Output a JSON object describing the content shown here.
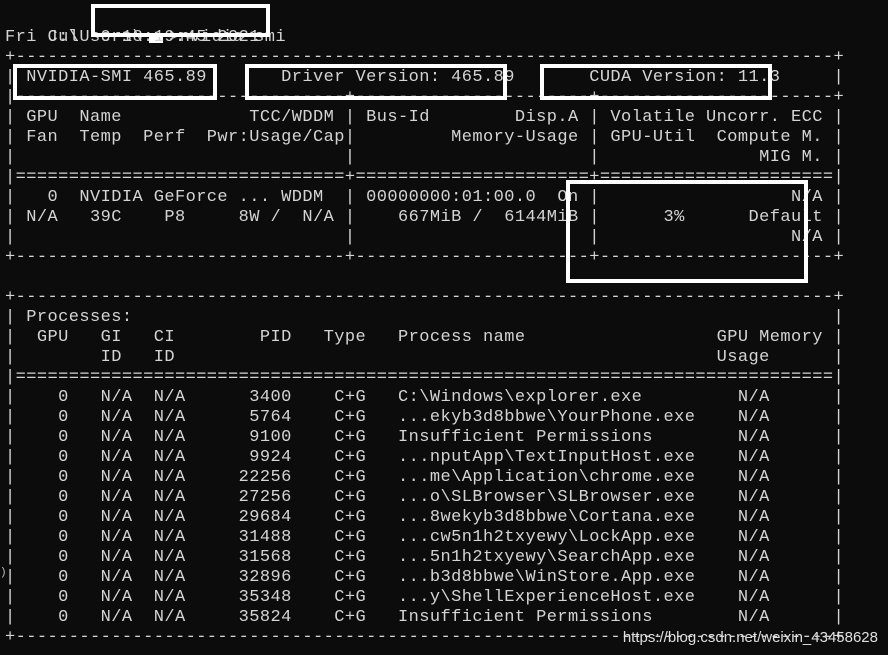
{
  "window": {
    "prompt_prefix": "C:\\Users\\",
    "username_icon": "redacted-username-icon",
    "command": ">nvidia-smi"
  },
  "terminal": {
    "lines": [
      "",
      "Fri Jul  9 18:19:45 2021",
      "+-----------------------------------------------------------------------------+",
      "| NVIDIA-SMI 465.89       Driver Version: 465.89       CUDA Version: 11.3     |",
      "|-------------------------------+----------------------+----------------------+",
      "| GPU  Name            TCC/WDDM | Bus-Id        Disp.A | Volatile Uncorr. ECC |",
      "| Fan  Temp  Perf  Pwr:Usage/Cap|         Memory-Usage | GPU-Util  Compute M. |",
      "|                               |                      |               MIG M. |",
      "|===============================+======================+======================|",
      "|   0  NVIDIA GeForce ... WDDM  | 00000000:01:00.0  On |                  N/A |",
      "| N/A   39C    P8     8W /  N/A |    667MiB /  6144MiB |      3%      Default |",
      "|                               |                      |                  N/A |",
      "+-------------------------------+----------------------+----------------------+",
      "",
      "+-----------------------------------------------------------------------------+",
      "| Processes:                                                                  |",
      "|  GPU   GI   CI        PID   Type   Process name                  GPU Memory |",
      "|        ID   ID                                                   Usage      |",
      "|=============================================================================|",
      "|    0   N/A  N/A      3400    C+G   C:\\Windows\\explorer.exe         N/A      |",
      "|    0   N/A  N/A      5764    C+G   ...ekyb3d8bbwe\\YourPhone.exe    N/A      |",
      "|    0   N/A  N/A      9100    C+G   Insufficient Permissions        N/A      |",
      "|    0   N/A  N/A      9924    C+G   ...nputApp\\TextInputHost.exe    N/A      |",
      "|    0   N/A  N/A     22256    C+G   ...me\\Application\\chrome.exe    N/A      |",
      "|    0   N/A  N/A     27256    C+G   ...o\\SLBrowser\\SLBrowser.exe    N/A      |",
      "|    0   N/A  N/A     29684    C+G   ...8wekyb3d8bbwe\\Cortana.exe    N/A      |",
      "|    0   N/A  N/A     31488    C+G   ...cw5n1h2txyewy\\LockApp.exe    N/A      |",
      "|    0   N/A  N/A     31568    C+G   ...5n1h2txyewy\\SearchApp.exe    N/A      |",
      "|    0   N/A  N/A     32896    C+G   ...b3d8bbwe\\WinStore.App.exe    N/A      |",
      "|    0   N/A  N/A     35348    C+G   ...y\\ShellExperienceHost.exe    N/A      |",
      "|    0   N/A  N/A     35824    C+G   Insufficient Permissions        N/A      |",
      "+-----------------------------------------------------------------------------+"
    ]
  },
  "watermark": "https://blog.csdn.net/weixin_43458628",
  "colors": {
    "background": "#0c0c0c",
    "text": "#d4d4d4",
    "annotation": "#ffffff"
  }
}
